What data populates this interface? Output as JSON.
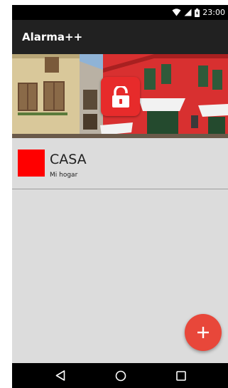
{
  "status_bar": {
    "time": "23:00",
    "icons": [
      "wifi-icon",
      "cell-signal-icon",
      "battery-icon"
    ]
  },
  "app_bar": {
    "title": "Alarma++"
  },
  "header": {
    "lock_icon": "unlocked-padlock-icon",
    "lock_color": "#e72b2b"
  },
  "list": {
    "items": [
      {
        "title": "CASA",
        "subtitle": "Mi hogar",
        "color": "#ff0000"
      }
    ]
  },
  "fab": {
    "icon": "plus-icon",
    "color": "#e8473a"
  },
  "nav_bar": {
    "buttons": [
      "back-icon",
      "home-icon",
      "recents-icon"
    ]
  }
}
